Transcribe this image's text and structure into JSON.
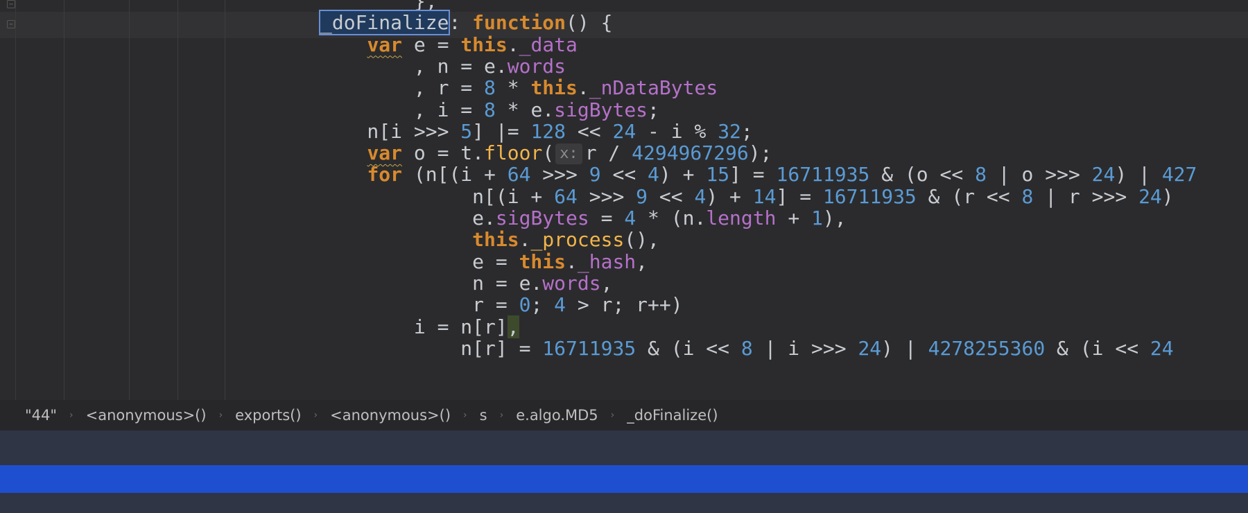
{
  "editor": {
    "fold_glyph": "−",
    "lines": [
      [
        {
          "t": "        "
        },
        {
          "t": "},",
          "c": "plain"
        }
      ],
      [
        {
          "t": "_doFinalize",
          "c": "sel"
        },
        {
          "t": ": ",
          "c": "plain"
        },
        {
          "t": "function",
          "c": "kw"
        },
        {
          "t": "() {",
          "c": "plain"
        }
      ],
      [
        {
          "t": "    "
        },
        {
          "t": "var",
          "c": "kw squiggle"
        },
        {
          "t": " e = ",
          "c": "plain"
        },
        {
          "t": "this",
          "c": "kw"
        },
        {
          "t": ".",
          "c": "plain"
        },
        {
          "t": "_data",
          "c": "prop"
        }
      ],
      [
        {
          "t": "        , n = e.",
          "c": "plain"
        },
        {
          "t": "words",
          "c": "prop"
        }
      ],
      [
        {
          "t": "        , r = ",
          "c": "plain"
        },
        {
          "t": "8",
          "c": "num"
        },
        {
          "t": " * ",
          "c": "plain"
        },
        {
          "t": "this",
          "c": "kw"
        },
        {
          "t": ".",
          "c": "plain"
        },
        {
          "t": "_nDataBytes",
          "c": "prop"
        }
      ],
      [
        {
          "t": "        , i = ",
          "c": "plain"
        },
        {
          "t": "8",
          "c": "num"
        },
        {
          "t": " * e.",
          "c": "plain"
        },
        {
          "t": "sigBytes",
          "c": "prop"
        },
        {
          "t": ";",
          "c": "plain"
        }
      ],
      [
        {
          "t": "    n[i >>> ",
          "c": "plain"
        },
        {
          "t": "5",
          "c": "num"
        },
        {
          "t": "] |= ",
          "c": "plain"
        },
        {
          "t": "128",
          "c": "num"
        },
        {
          "t": " << ",
          "c": "plain"
        },
        {
          "t": "24",
          "c": "num"
        },
        {
          "t": " - i % ",
          "c": "plain"
        },
        {
          "t": "32",
          "c": "num"
        },
        {
          "t": ";",
          "c": "plain"
        }
      ],
      [
        {
          "t": "    "
        },
        {
          "t": "var",
          "c": "kw squiggle"
        },
        {
          "t": " o = t.",
          "c": "plain"
        },
        {
          "t": "floor",
          "c": "fn"
        },
        {
          "t": "(",
          "c": "plain"
        },
        {
          "t": "x:",
          "c": "hint"
        },
        {
          "t": "r / ",
          "c": "plain"
        },
        {
          "t": "4294967296",
          "c": "num"
        },
        {
          "t": ");",
          "c": "plain"
        }
      ],
      [
        {
          "t": "    "
        },
        {
          "t": "for",
          "c": "kw"
        },
        {
          "t": " (n[(i + ",
          "c": "plain"
        },
        {
          "t": "64",
          "c": "num"
        },
        {
          "t": " >>> ",
          "c": "plain"
        },
        {
          "t": "9",
          "c": "num"
        },
        {
          "t": " << ",
          "c": "plain"
        },
        {
          "t": "4",
          "c": "num"
        },
        {
          "t": ") + ",
          "c": "plain"
        },
        {
          "t": "15",
          "c": "num"
        },
        {
          "t": "] = ",
          "c": "plain"
        },
        {
          "t": "16711935",
          "c": "num"
        },
        {
          "t": " & (o << ",
          "c": "plain"
        },
        {
          "t": "8",
          "c": "num"
        },
        {
          "t": " | o >>> ",
          "c": "plain"
        },
        {
          "t": "24",
          "c": "num"
        },
        {
          "t": ") | ",
          "c": "plain"
        },
        {
          "t": "427",
          "c": "num"
        }
      ],
      [
        {
          "t": "             n[(i + ",
          "c": "plain"
        },
        {
          "t": "64",
          "c": "num"
        },
        {
          "t": " >>> ",
          "c": "plain"
        },
        {
          "t": "9",
          "c": "num"
        },
        {
          "t": " << ",
          "c": "plain"
        },
        {
          "t": "4",
          "c": "num"
        },
        {
          "t": ") + ",
          "c": "plain"
        },
        {
          "t": "14",
          "c": "num"
        },
        {
          "t": "] = ",
          "c": "plain"
        },
        {
          "t": "16711935",
          "c": "num"
        },
        {
          "t": " & (r << ",
          "c": "plain"
        },
        {
          "t": "8",
          "c": "num"
        },
        {
          "t": " | r >>> ",
          "c": "plain"
        },
        {
          "t": "24",
          "c": "num"
        },
        {
          "t": ")",
          "c": "plain"
        }
      ],
      [
        {
          "t": "             e.",
          "c": "plain"
        },
        {
          "t": "sigBytes",
          "c": "prop"
        },
        {
          "t": " = ",
          "c": "plain"
        },
        {
          "t": "4",
          "c": "num"
        },
        {
          "t": " * (n.",
          "c": "plain"
        },
        {
          "t": "length",
          "c": "prop"
        },
        {
          "t": " + ",
          "c": "plain"
        },
        {
          "t": "1",
          "c": "num"
        },
        {
          "t": "),",
          "c": "plain"
        }
      ],
      [
        {
          "t": "             "
        },
        {
          "t": "this",
          "c": "kw"
        },
        {
          "t": ".",
          "c": "plain"
        },
        {
          "t": "_process",
          "c": "fn"
        },
        {
          "t": "(),",
          "c": "plain"
        }
      ],
      [
        {
          "t": "             e = ",
          "c": "plain"
        },
        {
          "t": "this",
          "c": "kw"
        },
        {
          "t": ".",
          "c": "plain"
        },
        {
          "t": "_hash",
          "c": "prop"
        },
        {
          "t": ",",
          "c": "plain"
        }
      ],
      [
        {
          "t": "             n = e.",
          "c": "plain"
        },
        {
          "t": "words",
          "c": "prop"
        },
        {
          "t": ",",
          "c": "plain"
        }
      ],
      [
        {
          "t": "             r = ",
          "c": "plain"
        },
        {
          "t": "0",
          "c": "num"
        },
        {
          "t": "; ",
          "c": "plain"
        },
        {
          "t": "4",
          "c": "num"
        },
        {
          "t": " > r; r++)",
          "c": "plain"
        }
      ],
      [
        {
          "t": "        i = n[r]",
          "c": "plain"
        },
        {
          "t": ",",
          "c": "plain brace-hl"
        }
      ],
      [
        {
          "t": "            n[r] = ",
          "c": "plain"
        },
        {
          "t": "16711935",
          "c": "num"
        },
        {
          "t": " & (i << ",
          "c": "plain"
        },
        {
          "t": "8",
          "c": "num"
        },
        {
          "t": " | i >>> ",
          "c": "plain"
        },
        {
          "t": "24",
          "c": "num"
        },
        {
          "t": ") | ",
          "c": "plain"
        },
        {
          "t": "4278255360",
          "c": "num"
        },
        {
          "t": " & (i << ",
          "c": "plain"
        },
        {
          "t": "24",
          "c": "num"
        }
      ]
    ]
  },
  "breadcrumb": {
    "items": [
      "\"44\"",
      "<anonymous>()",
      "exports()",
      "<anonymous>()",
      "s",
      "e.algo.MD5",
      "_doFinalize()"
    ],
    "separator": "›"
  },
  "colors": {
    "accent_underline": "#f0245d",
    "status_bar": "#1e4fd0"
  }
}
